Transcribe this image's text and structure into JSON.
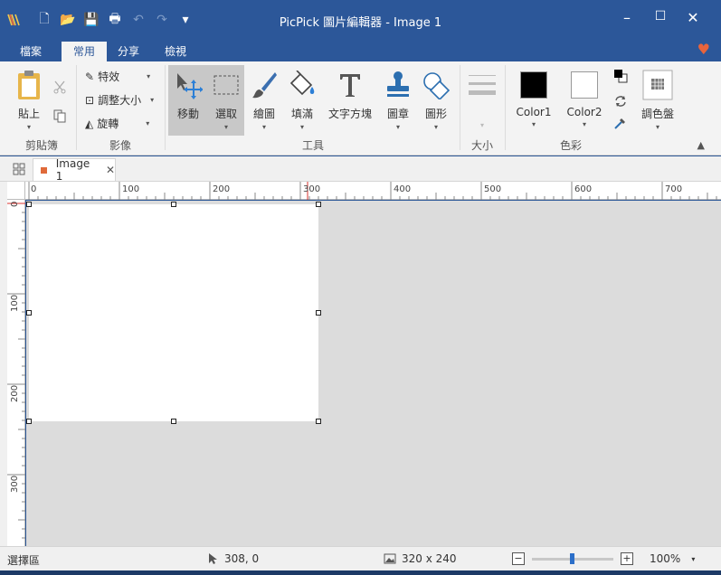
{
  "window": {
    "title": "PicPick 圖片編輯器 - Image 1",
    "minimize": "–",
    "maximize": "☐",
    "close": "✕"
  },
  "qat": {
    "new": "🗋",
    "open": "📂",
    "save": "💾",
    "print": "🖶",
    "undo": "↶",
    "redo": "↷",
    "more": "▾"
  },
  "tabs": [
    "檔案",
    "常用",
    "分享",
    "檢視"
  ],
  "active_tab": "常用",
  "ribbon": {
    "clipboard": {
      "paste": "貼上",
      "group": "剪貼簿"
    },
    "image": {
      "effects": "特效",
      "resize": "調整大小",
      "rotate": "旋轉",
      "group": "影像"
    },
    "tools": {
      "move": "移動",
      "select": "選取",
      "draw": "繪圖",
      "fill": "填滿",
      "text": "文字方塊",
      "stamp": "圖章",
      "shape": "圖形",
      "group": "工具"
    },
    "size": {
      "group": "大小"
    },
    "colors": {
      "color1": "Color1",
      "color2": "Color2",
      "palette": "調色盤",
      "group": "色彩"
    }
  },
  "document": {
    "tab_name": "Image 1"
  },
  "rulers": {
    "h": [
      "0",
      "100",
      "200",
      "300",
      "400",
      "500",
      "600",
      "700"
    ],
    "v": [
      "0",
      "100",
      "200",
      "300"
    ]
  },
  "status": {
    "tool": "選擇區",
    "cursor": "308, 0",
    "image_size": "320 x 240",
    "zoom_minus": "−",
    "zoom_plus": "+",
    "zoom": "100%"
  },
  "colors": {
    "titlebar": "#2c5799",
    "accent_orange": "#e06a3a",
    "color1": "#000000",
    "color2": "#ffffff"
  }
}
